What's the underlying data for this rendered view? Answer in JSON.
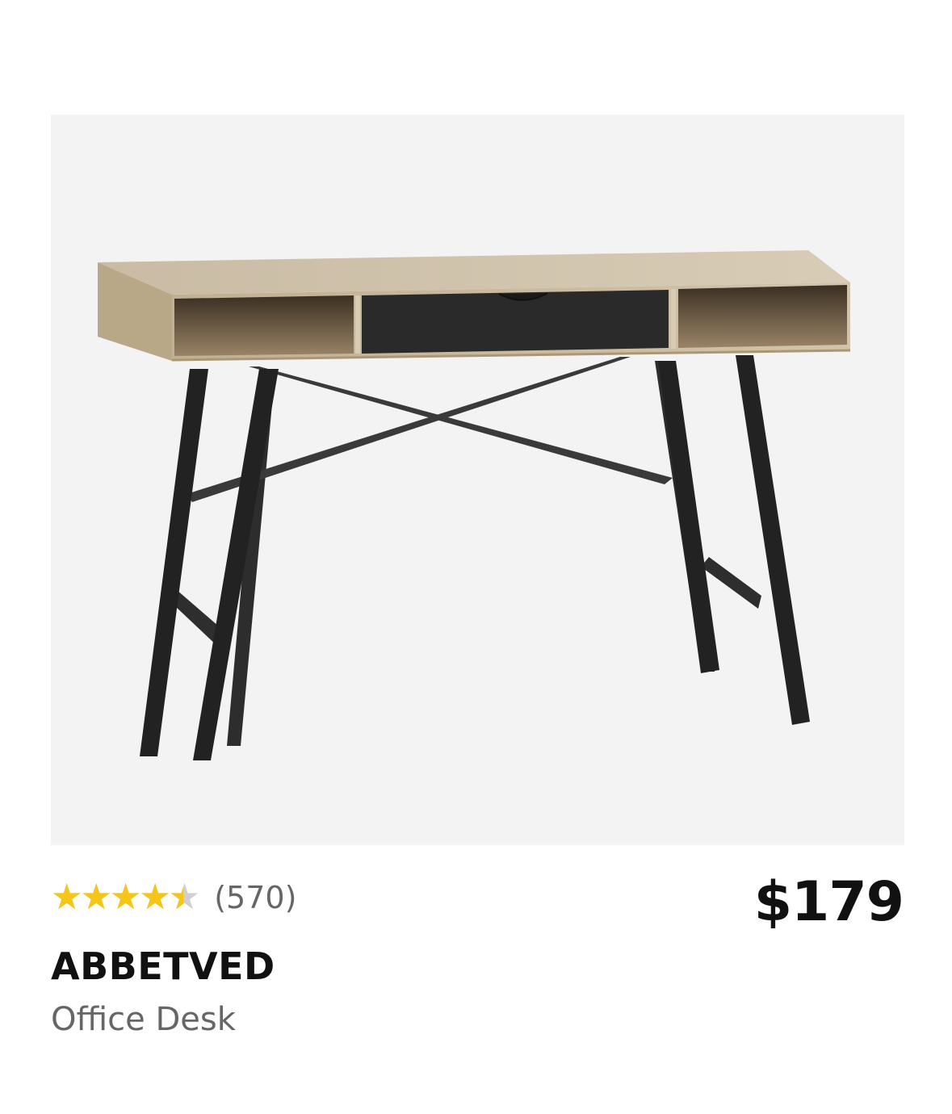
{
  "product": {
    "image_alt": "desk-product-photo",
    "rating": {
      "value": 4.5,
      "max": 5,
      "stars_glyphs": "★★★★★",
      "star_color": "#f5c518",
      "empty_color": "#cfcfcf",
      "review_count": "(570)"
    },
    "price": "$179",
    "name": "ABBETVED",
    "type": "Office Desk"
  }
}
